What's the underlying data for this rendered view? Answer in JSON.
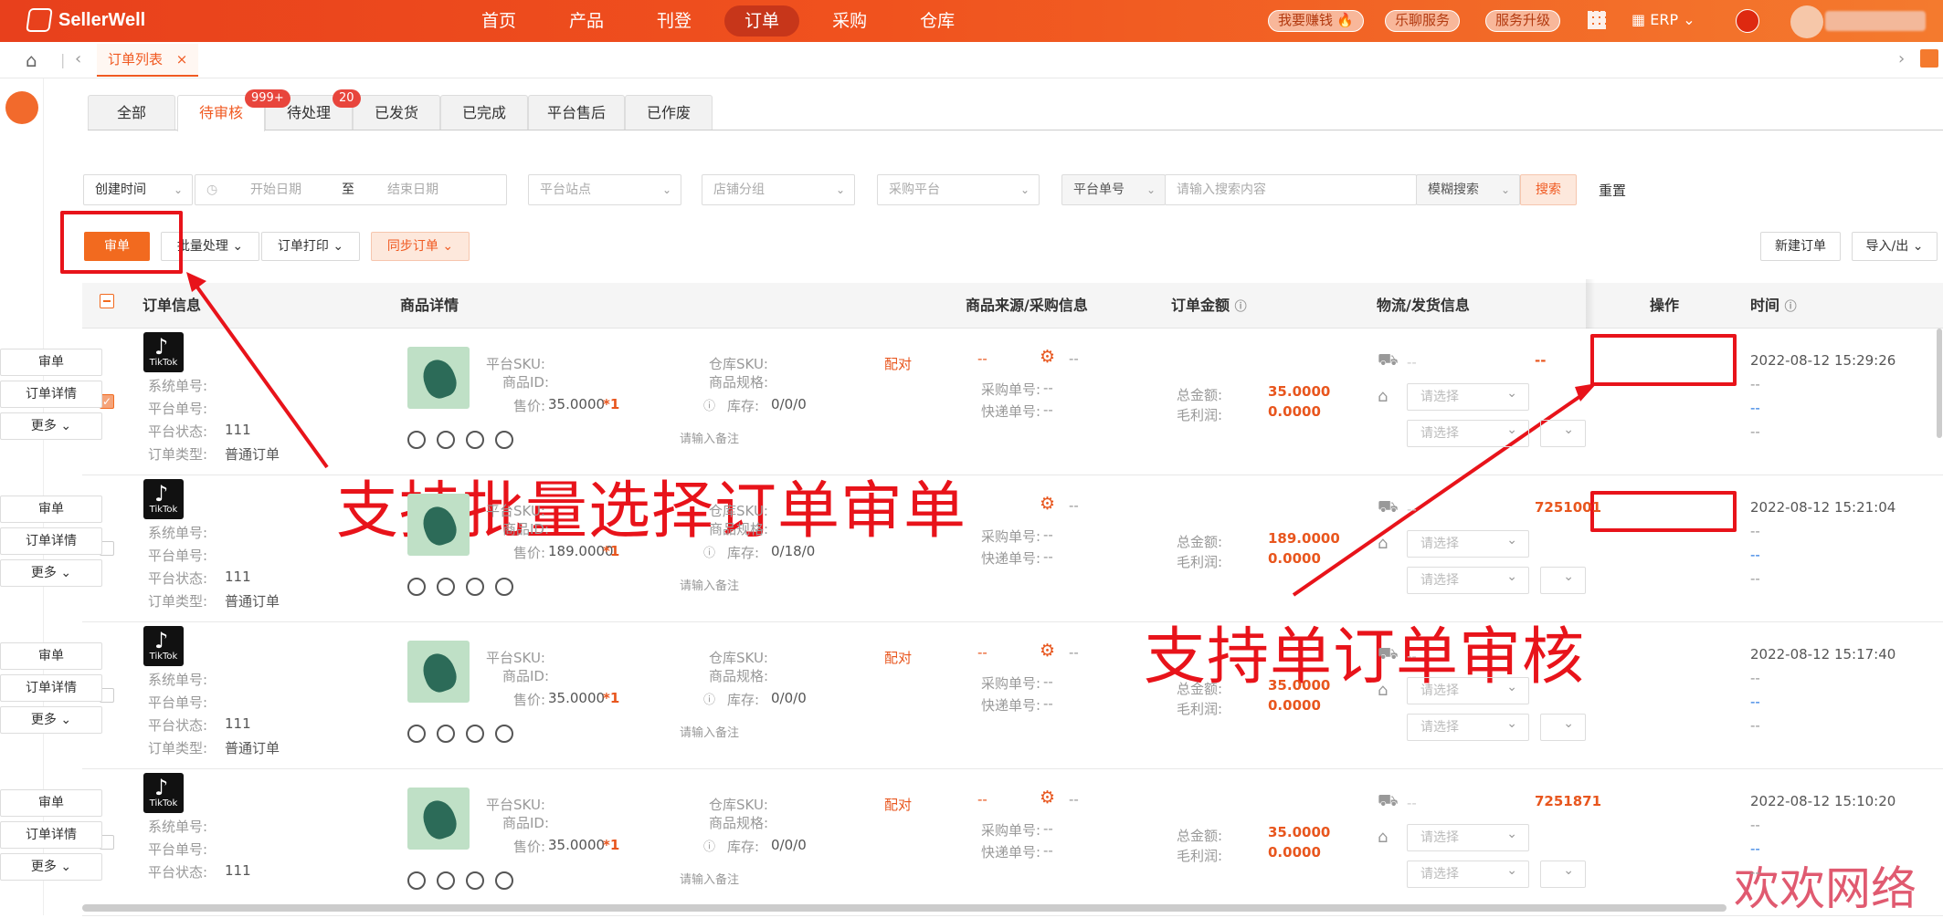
{
  "app": {
    "logo": "SellerWell",
    "nav": [
      "首页",
      "产品",
      "刊登",
      "订单",
      "采购",
      "仓库"
    ],
    "active_nav": "订单",
    "pills": [
      "我要赚钱",
      "乐聊服务",
      "服务升级"
    ],
    "erp": "ERP"
  },
  "tabbar": {
    "tab": "订单列表",
    "close": "×"
  },
  "status_tabs": [
    {
      "label": "全部"
    },
    {
      "label": "待审核",
      "badge": "999+"
    },
    {
      "label": "待处理",
      "badge": "20"
    },
    {
      "label": "已发货"
    },
    {
      "label": "已完成"
    },
    {
      "label": "平台售后"
    },
    {
      "label": "已作废"
    }
  ],
  "filters": {
    "time_type": "创建时间",
    "start": "开始日期",
    "to": "至",
    "end": "结束日期",
    "site": "平台站点",
    "shop_group": "店铺分组",
    "purchase_platform": "采购平台",
    "order_no_type": "平台单号",
    "search_placeholder": "请输入搜索内容",
    "match": "模糊搜索",
    "search": "搜索",
    "reset": "重置"
  },
  "toolbar": {
    "audit": "审单",
    "batch": "批量处理",
    "print": "订单打印",
    "sync": "同步订单",
    "new_order": "新建订单",
    "import_export": "导入/出"
  },
  "columns": [
    "订单信息",
    "商品详情",
    "商品来源/采购信息",
    "订单金额",
    "物流/发货信息",
    "操作",
    "时间"
  ],
  "labels": {
    "sys_no": "系统单号:",
    "plat_no": "平台单号:",
    "plat_status": "平台状态:",
    "order_type": "订单类型:",
    "plat_sku": "平台SKU:",
    "item_id": "商品ID:",
    "price": "售价:",
    "wh_sku": "仓库SKU:",
    "spec": "商品规格:",
    "stock": "库存:",
    "pair": "配对",
    "remark": "请输入备注",
    "purchase_no": "采购单号:",
    "express_no": "快递单号:",
    "total": "总金额:",
    "profit": "毛利润:",
    "select": "请选择",
    "dash": "--",
    "op_audit": "审单",
    "op_detail": "订单详情",
    "op_more": "更多"
  },
  "orders": [
    {
      "status": "111",
      "type": "普通订单",
      "price": "35.0000",
      "qty": "*1",
      "stock": "0/0/0",
      "total": "35.0000",
      "profit": "0.0000",
      "time": "2022-08-12 15:29:26",
      "track": "--",
      "checked": true
    },
    {
      "status": "111",
      "type": "普通订单",
      "price": "189.0000",
      "qty": "*1",
      "stock": "0/18/0",
      "total": "189.0000",
      "profit": "0.0000",
      "time": "2022-08-12 15:21:04",
      "track": "7251001",
      "checked": false
    },
    {
      "status": "111",
      "type": "普通订单",
      "price": "35.0000",
      "qty": "*1",
      "stock": "0/0/0",
      "total": "35.0000",
      "profit": "0.0000",
      "time": "2022-08-12 15:17:40",
      "track": "",
      "checked": false
    },
    {
      "status": "111",
      "type": "",
      "price": "35.0000",
      "qty": "*1",
      "stock": "0/0/0",
      "total": "35.0000",
      "profit": "0.0000",
      "time": "2022-08-12 15:10:20",
      "track": "7251871",
      "checked": false
    }
  ],
  "annotations": {
    "batch": "支持批量选择订单审单",
    "single": "支持单订单审核",
    "watermark": "欢欢网络"
  }
}
